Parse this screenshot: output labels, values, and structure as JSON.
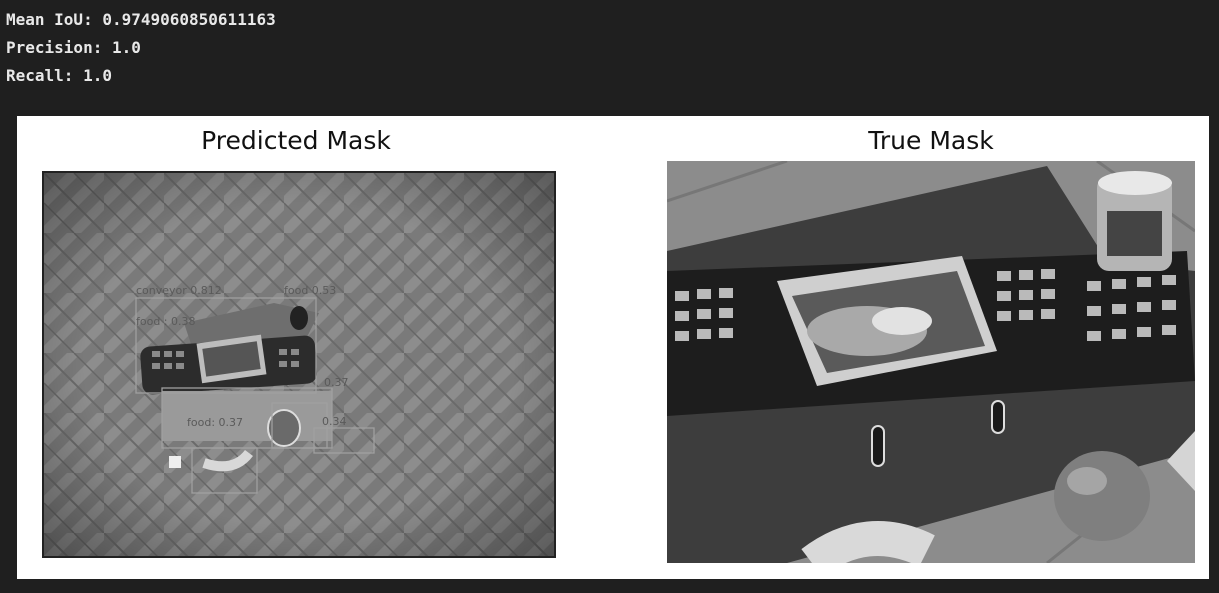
{
  "output": {
    "lines": [
      "Mean IoU: 0.9749060850611163",
      "Precision: 1.0",
      "Recall: 1.0"
    ]
  },
  "figure": {
    "panels": [
      {
        "title": "Predicted Mask",
        "image_desc": "grayscale overhead photo of keyboard, snack bag, can, fruit on herringbone floor with detection boxes",
        "labels": [
          "conveyor 0.812",
          "food : 0.38",
          "food: 0.37",
          "food 0.53",
          "0.34",
          "0.37"
        ]
      },
      {
        "title": "True Mask",
        "image_desc": "grayscale close-up of keyboard with snack bag, can and fruit on floor"
      }
    ]
  }
}
